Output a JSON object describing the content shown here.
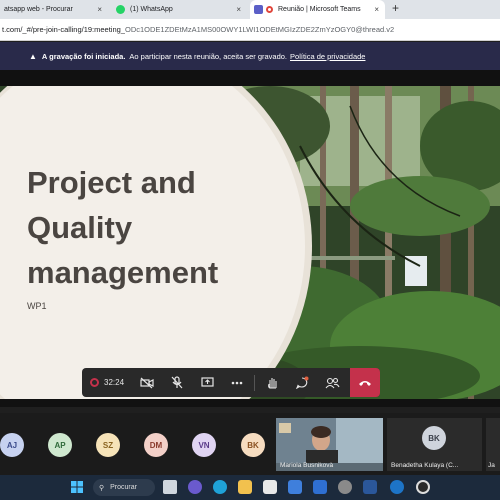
{
  "browser": {
    "tabs": [
      {
        "label": "atsapp web - Procurar",
        "icon": "search-tab-icon",
        "color": "#4285f4"
      },
      {
        "label": "(1) WhatsApp",
        "icon": "whatsapp-icon",
        "color": "#25d366"
      },
      {
        "label": "Reunião | Microsoft Teams",
        "icon": "teams-icon",
        "color": "#5b5fc7"
      }
    ],
    "tab_close": "×",
    "new_tab": "+",
    "url_prefix": "t.com/_#/pre-join-calling/19:meeting_",
    "url_rest": "ODc1ODE1ZDEtMzA1MS00OWY1LWI1ODEtMGIzZDE2ZmYzOGY0@thread.v2"
  },
  "banner": {
    "bold": "A gravação foi iniciada.",
    "text": "Ao participar nesta reunião, aceita ser gravado.",
    "link": "Política de privacidade"
  },
  "slide": {
    "title_line1": "Project and",
    "title_line2": "Quality",
    "title_line3": "management",
    "subtitle": "WP1"
  },
  "controls": {
    "timer": "32:24"
  },
  "participants": [
    {
      "initials": "AJ",
      "color": "#c7d2f0"
    },
    {
      "initials": "AP",
      "color": "#cfe8cf"
    },
    {
      "initials": "SZ",
      "color": "#f6e3b8"
    },
    {
      "initials": "DM",
      "color": "#f3d0c8"
    },
    {
      "initials": "VN",
      "color": "#e0d4f2"
    },
    {
      "initials": "BK",
      "color": "#f6dcc0"
    }
  ],
  "video_tile": {
    "name": "Mariola Busnikovà"
  },
  "tile_bk": {
    "initials": "BK",
    "name": "Benadetha Kulaya (C..."
  },
  "tile_edge": {
    "name": "Ja"
  },
  "taskbar": {
    "search_label": "Procurar"
  }
}
